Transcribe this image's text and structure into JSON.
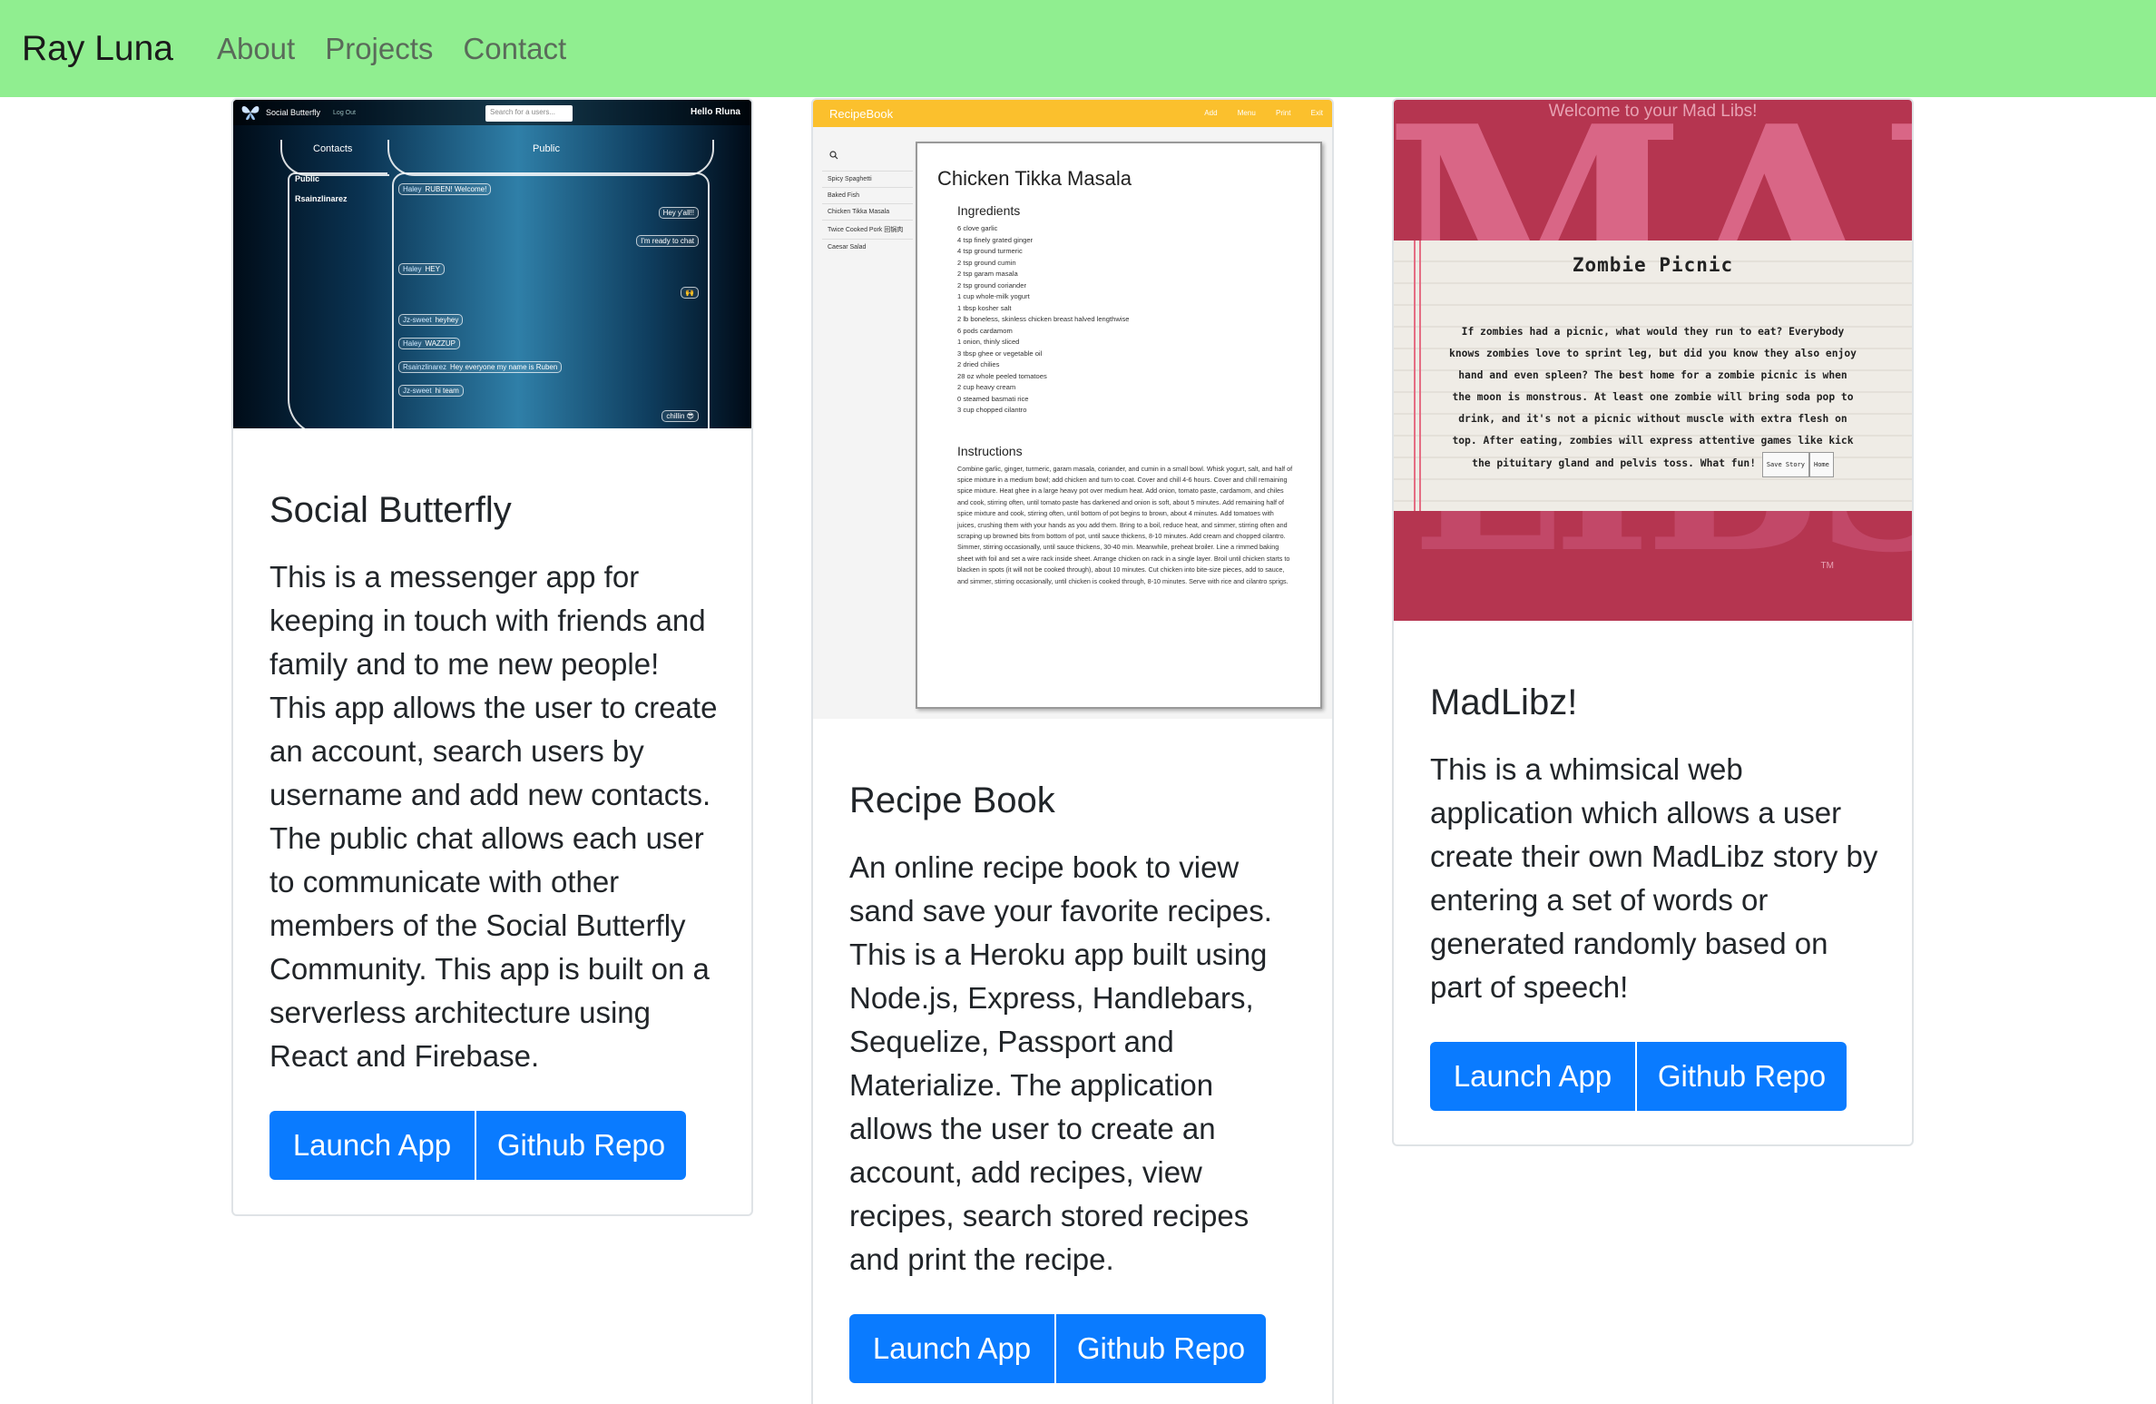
{
  "navbar": {
    "brand": "Ray Luna",
    "links": [
      "About",
      "Projects",
      "Contact"
    ],
    "background": "#90ee90"
  },
  "projects": [
    {
      "title": "Social Butterfly",
      "description": "This is a messenger app for keeping in touch with friends and family and to me new people! This app allows the user to create an account, search users by username and add new contacts. The public chat allows each user to communicate with other members of the Social Butterfly Community. This app is built on a serverless architecture using React and Firebase.",
      "launch_label": "Launch App",
      "repo_label": "Github Repo",
      "screenshot": {
        "app_name": "Social Butterfly",
        "logout": "Log Out",
        "search_placeholder": "Search for a users...",
        "greeting": "Hello Rluna",
        "tab_contacts": "Contacts",
        "tab_public": "Public",
        "sidebar": [
          "Public",
          "Rsainzlinarez"
        ],
        "messages": [
          {
            "who": "Haley",
            "text": "RUBEN! Welcome!"
          },
          {
            "who": "",
            "text": "Hey y'all!!"
          },
          {
            "who": "",
            "text": "I'm ready to chat"
          },
          {
            "who": "Haley",
            "text": "HEY"
          },
          {
            "who": "",
            "text": "🙌"
          },
          {
            "who": "Jz-sweet",
            "text": "heyhey"
          },
          {
            "who": "Haley",
            "text": "WAZZUP"
          },
          {
            "who": "Rsainzlinarez",
            "text": "Hey everyone my name is Ruben"
          },
          {
            "who": "Jz-sweet",
            "text": "hi team"
          },
          {
            "who": "",
            "text": "chillin 😎"
          }
        ]
      }
    },
    {
      "title": "Recipe Book",
      "description": "An online recipe book to view sand save your favorite recipes. This is a Heroku app built using Node.js, Express, Handlebars, Sequelize, Passport and Materialize. The application allows the user to create an account, add recipes, view recipes, search stored recipes and print the recipe.",
      "launch_label": "Launch App",
      "repo_label": "Github Repo",
      "screenshot": {
        "app_name": "RecipeBook",
        "top_links": "Add Menu Print Exit",
        "search_icon": "search-icon",
        "sidebar": [
          "Spicy Spaghetti",
          "Baked Fish",
          "Chicken Tikka Masala",
          "Twice Cooked Pork 回锅肉",
          "Caesar Salad"
        ],
        "recipe_title": "Chicken Tikka Masala",
        "ingredients_heading": "Ingredients",
        "ingredients": [
          "6 clove garlic",
          "4 tsp finely grated ginger",
          "4 tsp ground turmeric",
          "2 tsp ground cumin",
          "2 tsp garam masala",
          "2 tsp ground coriander",
          "1 cup whole-milk yogurt",
          "1 tbsp kosher salt",
          "2 lb boneless, skinless chicken breast halved lengthwise",
          "6 pods cardamom",
          "1 onion, thinly sliced",
          "3 tbsp ghee or vegetable oil",
          "2 dried chilies",
          "28 oz whole peeled tomatoes",
          "2 cup heavy cream",
          "0 steamed basmati rice",
          "3 cup chopped cilantro"
        ],
        "instructions_heading": "Instructions",
        "instructions": "Combine garlic, ginger, turmeric, garam masala, coriander, and cumin in a small bowl. Whisk yogurt, salt, and half of spice mixture in a medium bowl; add chicken and turn to coat. Cover and chill 4-6 hours. Cover and chill remaining spice mixture. Heat ghee in a large heavy pot over medium heat. Add onion, tomato paste, cardamom, and chiles and cook, stirring often, until tomato paste has darkened and onion is soft, about 5 minutes. Add remaining half of spice mixture and cook, stirring often, until bottom of pot begins to brown, about 4 minutes. Add tomatoes with juices, crushing them with your hands as you add them. Bring to a boil, reduce heat, and simmer, stirring often and scraping up browned bits from bottom of pot, until sauce thickens, 8-10 minutes. Add cream and chopped cilantro. Simmer, stirring occasionally, until sauce thickens, 30-40 min. Meanwhile, preheat broiler. Line a rimmed baking sheet with foil and set a wire rack inside sheet. Arrange chicken on rack in a single layer. Broil until chicken starts to blacken in spots (it will not be cooked through), about 10 minutes. Cut chicken into bite-size pieces, add to sauce, and simmer, stirring occasionally, until chicken is cooked through, 8-10 minutes. Serve with rice and cilantro sprigs."
      }
    },
    {
      "title": "MadLibz!",
      "description": "This is a whimsical web application which allows a user create their own MadLibz story by entering a set of words or generated randomly based on part of speech!",
      "launch_label": "Launch App",
      "repo_label": "Github Repo",
      "screenshot": {
        "welcome": "Welcome to your Mad Libs!",
        "logo_top": "MAD",
        "logo_bottom": "LIBS",
        "story_title": "Zombie Picnic",
        "story": "If zombies had a picnic, what would they run to eat? Everybody knows zombies love to sprint leg, but did you know they also enjoy hand and even spleen? The best home for a zombie picnic is when the moon is monstrous. At least one zombie will bring soda pop to drink, and it's not a picnic without muscle with extra flesh on top. After eating, zombies will express attentive games like kick the pituitary gland and pelvis toss. What fun!",
        "save_story": "Save Story",
        "home": "Home",
        "trademark": "TM"
      }
    }
  ],
  "colors": {
    "button": "#0a7bff",
    "card_border": "#dfe3e6"
  }
}
